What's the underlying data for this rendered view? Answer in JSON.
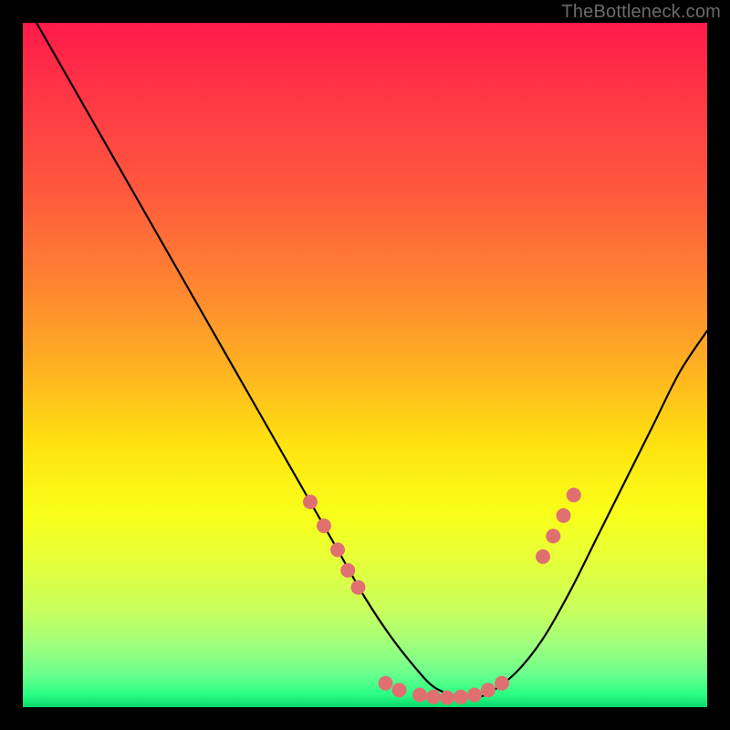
{
  "watermark": "TheBottleneck.com",
  "chart_data": {
    "type": "line",
    "title": "",
    "xlabel": "",
    "ylabel": "",
    "xlim": [
      0,
      100
    ],
    "ylim": [
      0,
      100
    ],
    "series": [
      {
        "name": "bottleneck-curve",
        "x": [
          2,
          6,
          10,
          14,
          18,
          22,
          26,
          30,
          34,
          38,
          42,
          46,
          50,
          54,
          58,
          60,
          62,
          64,
          66,
          68,
          72,
          76,
          80,
          84,
          88,
          92,
          96,
          100
        ],
        "y": [
          100,
          93,
          86,
          79,
          72,
          65,
          58,
          51,
          44,
          37,
          30,
          23,
          16,
          10,
          5,
          3,
          2,
          1.5,
          1.5,
          2,
          5,
          10,
          17,
          25,
          33,
          41,
          49,
          55
        ]
      }
    ],
    "markers": {
      "name": "highlight-dots",
      "color": "#e07070",
      "points": [
        {
          "x": 42,
          "y": 30
        },
        {
          "x": 44,
          "y": 26.5
        },
        {
          "x": 46,
          "y": 23
        },
        {
          "x": 47.5,
          "y": 20
        },
        {
          "x": 49,
          "y": 17.5
        },
        {
          "x": 53,
          "y": 3.5
        },
        {
          "x": 55,
          "y": 2.5
        },
        {
          "x": 58,
          "y": 1.8
        },
        {
          "x": 60,
          "y": 1.5
        },
        {
          "x": 62,
          "y": 1.4
        },
        {
          "x": 64,
          "y": 1.5
        },
        {
          "x": 66,
          "y": 1.8
        },
        {
          "x": 68,
          "y": 2.5
        },
        {
          "x": 70,
          "y": 3.5
        },
        {
          "x": 76,
          "y": 22
        },
        {
          "x": 77.5,
          "y": 25
        },
        {
          "x": 79,
          "y": 28
        },
        {
          "x": 80.5,
          "y": 31
        }
      ]
    }
  }
}
